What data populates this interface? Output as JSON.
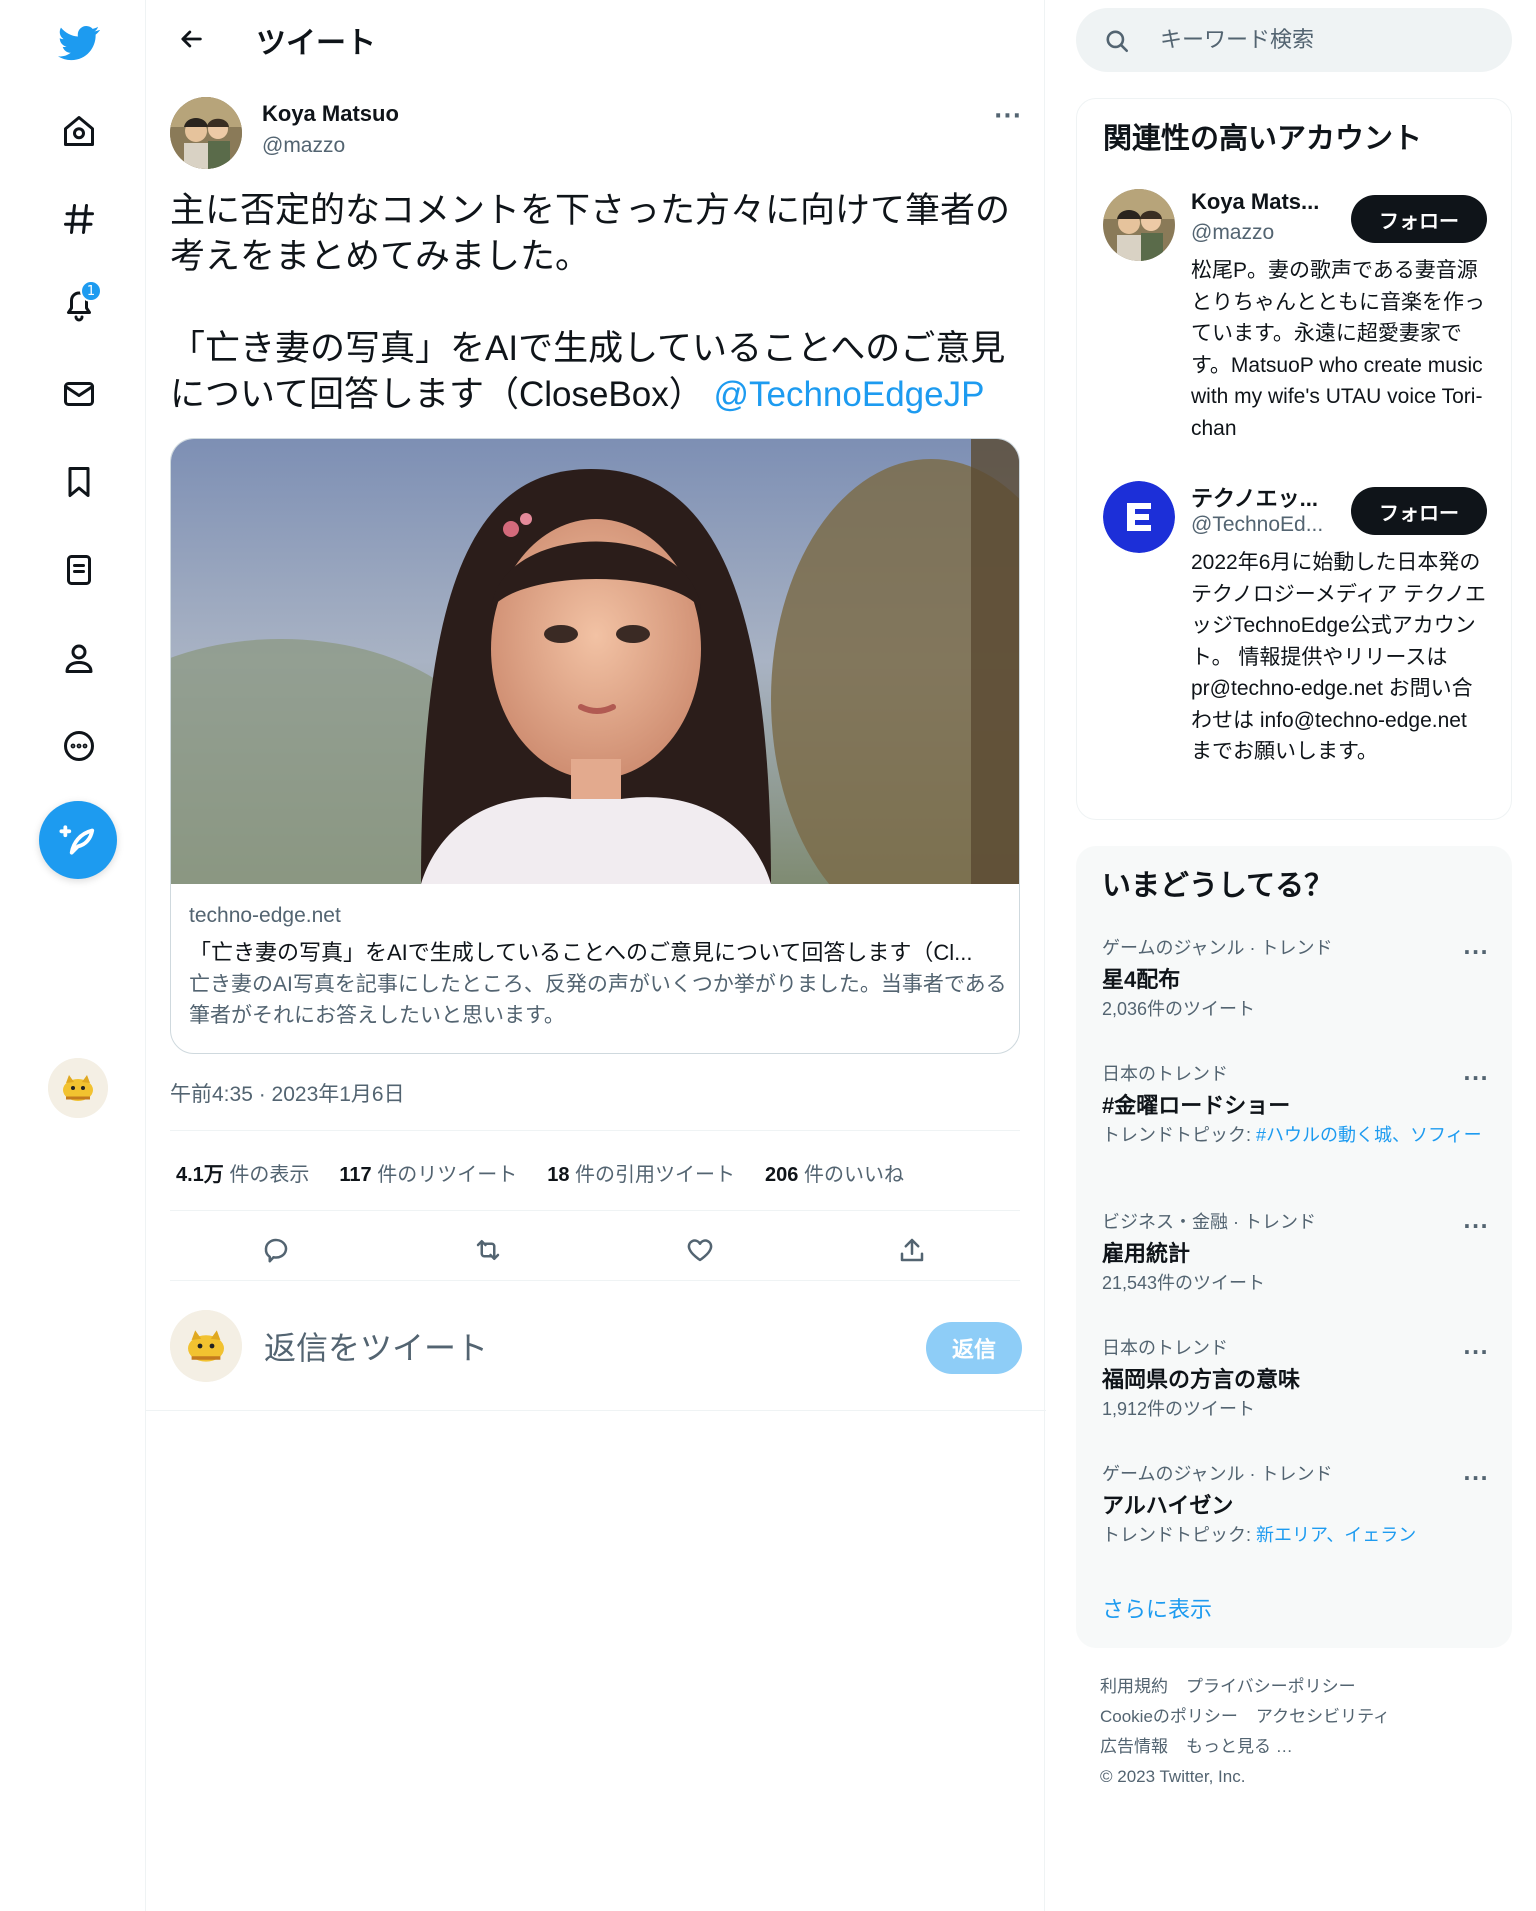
{
  "nav": {
    "notifications_badge": "1"
  },
  "header": {
    "title": "ツイート"
  },
  "tweet": {
    "author_name": "Koya Matsuo",
    "author_handle": "@mazzo",
    "text_main": "主に否定的なコメントを下さった方々に向けて筆者の考えをまとめてみました。\n\n「亡き妻の写真」をAIで生成していることへのご意見について回答します（CloseBox） ",
    "mention": "@TechnoEdgeJP",
    "card": {
      "domain": "techno-edge.net",
      "title": "「亡き妻の写真」をAIで生成していることへのご意見について回答します（Cl...",
      "description": "亡き妻のAI写真を記事にしたところ、反発の声がいくつか挙がりました。当事者である筆者がそれにお答えしたいと思います。"
    },
    "timestamp": "午前4:35 · 2023年1月6日",
    "stats": [
      {
        "count": "4.1万",
        "label": "件の表示"
      },
      {
        "count": "117",
        "label": "件のリツイート"
      },
      {
        "count": "18",
        "label": "件の引用ツイート"
      },
      {
        "count": "206",
        "label": "件のいいね"
      }
    ]
  },
  "reply": {
    "placeholder": "返信をツイート",
    "button": "返信"
  },
  "search": {
    "placeholder": "キーワード検索"
  },
  "accounts": {
    "title": "関連性の高いアカウント",
    "items": [
      {
        "name": "Koya Mats...",
        "handle": "@mazzo",
        "follow": "フォロー",
        "bio": "松尾P。妻の歌声である妻音源とりちゃんとともに音楽を作っています。永遠に超愛妻家です。MatsuoP who create music with my wife's UTAU voice Tori-chan"
      },
      {
        "name": "テクノエッ...",
        "handle": "@TechnoEd...",
        "follow": "フォロー",
        "bio": "2022年6月に始動した日本発のテクノロジーメディア テクノエッジTechnoEdge公式アカウント。 情報提供やリリースは pr@techno-edge.net お問い合わせは info@techno-edge.net までお願いします。"
      }
    ]
  },
  "trends": {
    "title": "いまどうしてる？",
    "items": [
      {
        "context": "ゲームのジャンル · トレンド",
        "name": "星4配布",
        "sub": "2,036件のツイート"
      },
      {
        "context": "日本のトレンド",
        "name": "#金曜ロードショー",
        "sub_prefix": "トレンドトピック: ",
        "sub_links": "#ハウルの動く城、ソフィー"
      },
      {
        "context": "ビジネス・金融 · トレンド",
        "name": "雇用統計",
        "sub": "21,543件のツイート"
      },
      {
        "context": "日本のトレンド",
        "name": "福岡県の方言の意味",
        "sub": "1,912件のツイート"
      },
      {
        "context": "ゲームのジャンル · トレンド",
        "name": "アルハイゼン",
        "sub_prefix": "トレンドトピック: ",
        "sub_links": "新エリア、イェラン"
      }
    ],
    "show_more": "さらに表示"
  },
  "footer": {
    "links_line1": [
      "利用規約",
      "プライバシーポリシー"
    ],
    "links_line2": [
      "Cookieのポリシー",
      "アクセシビリティ"
    ],
    "links_line3": [
      "広告情報",
      "もっと見る …"
    ],
    "copyright": "© 2023 Twitter, Inc."
  },
  "colors": {
    "accent": "#1d9bf0",
    "text": "#0f1419",
    "muted": "#536471",
    "follow_bg": "#0f1419",
    "reply_disabled": "#8ecdf7"
  }
}
